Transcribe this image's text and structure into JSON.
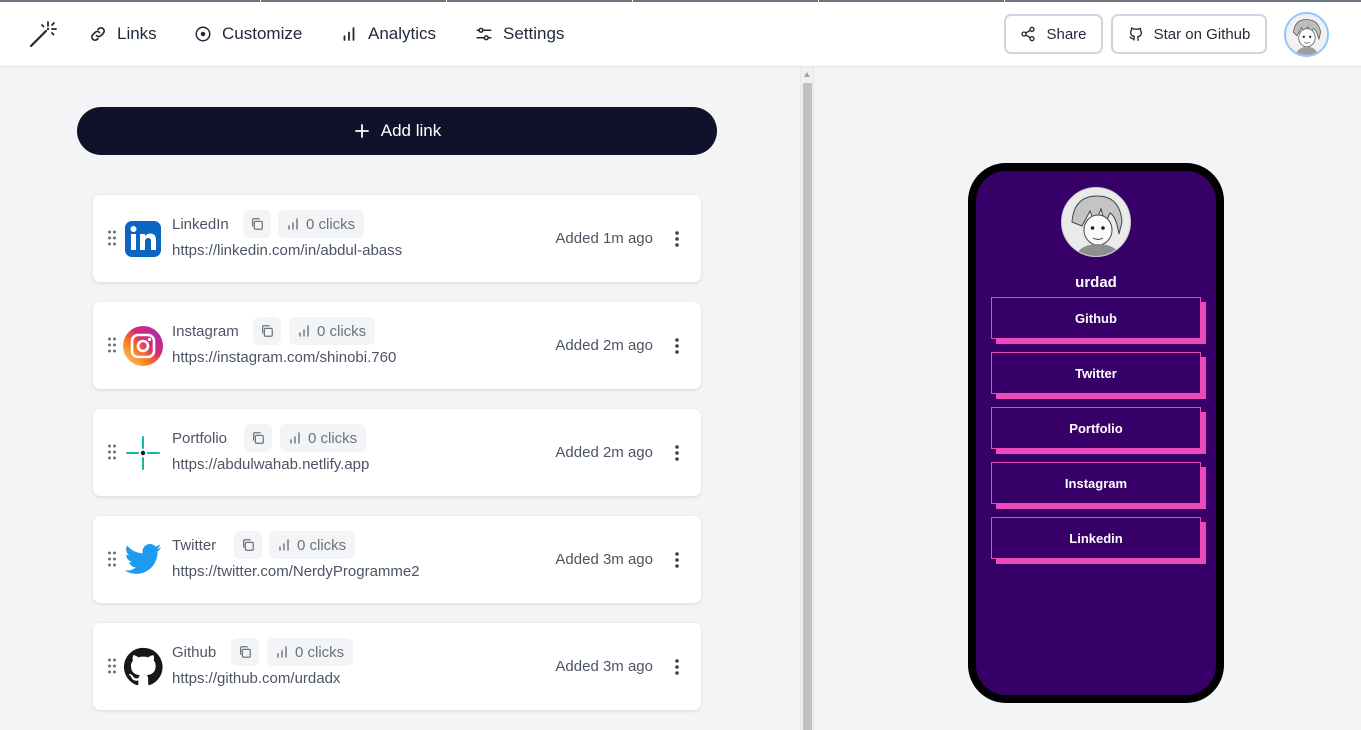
{
  "nav": {
    "items": [
      {
        "label": "Links",
        "icon": "link-icon"
      },
      {
        "label": "Customize",
        "icon": "customize-icon"
      },
      {
        "label": "Analytics",
        "icon": "analytics-icon"
      },
      {
        "label": "Settings",
        "icon": "settings-icon"
      }
    ],
    "share_label": "Share",
    "github_label": "Star on Github"
  },
  "add_link_label": "Add link",
  "links": [
    {
      "title": "LinkedIn",
      "url": "https://linkedin.com/in/abdul-abass",
      "clicks": "0 clicks",
      "added": "Added 1m ago",
      "icon": "linkedin-icon"
    },
    {
      "title": "Instagram",
      "url": "https://instagram.com/shinobi.760",
      "clicks": "0 clicks",
      "added": "Added 2m ago",
      "icon": "instagram-icon"
    },
    {
      "title": "Portfolio",
      "url": "https://abdulwahab.netlify.app",
      "clicks": "0 clicks",
      "added": "Added 2m ago",
      "icon": "portfolio-icon"
    },
    {
      "title": "Twitter",
      "url": "https://twitter.com/NerdyProgramme2",
      "clicks": "0 clicks",
      "added": "Added 3m ago",
      "icon": "twitter-icon"
    },
    {
      "title": "Github",
      "url": "https://github.com/urdadx",
      "clicks": "0 clicks",
      "added": "Added 3m ago",
      "icon": "github-icon"
    }
  ],
  "preview": {
    "username": "urdad",
    "links": [
      "Github",
      "Twitter",
      "Portfolio",
      "Instagram",
      "Linkedin"
    ],
    "colors": {
      "background": "#360068",
      "accent": "#ec4aba"
    }
  },
  "colors": {
    "primary": "#12112b",
    "page_bg": "#f3f4f6"
  }
}
